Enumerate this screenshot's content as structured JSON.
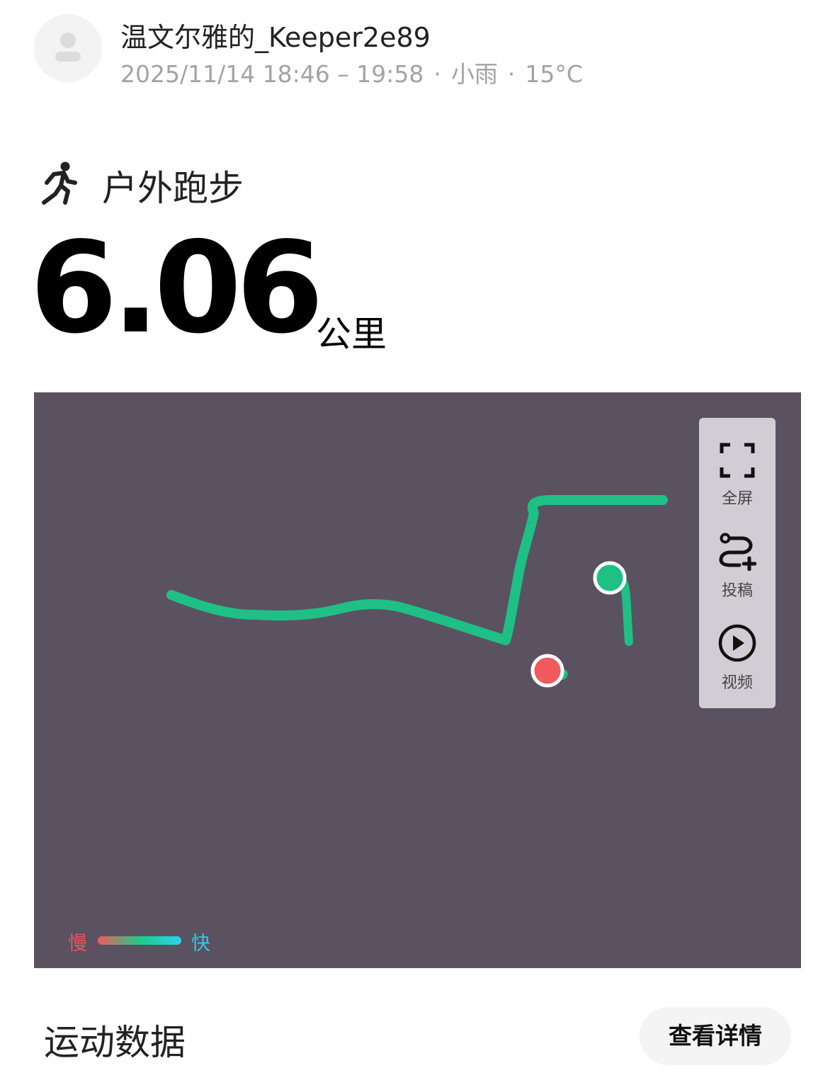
{
  "header": {
    "username": "温文尔雅的_Keeper2e89",
    "time_range": "2025/11/14 18:46 – 19:58",
    "separator": "·",
    "weather": "小雨",
    "temperature": "15°C"
  },
  "activity": {
    "type_label": "户外跑步",
    "icon": "running-person-icon",
    "distance_value": "6.06",
    "distance_unit": "公里"
  },
  "map": {
    "background_color": "#5a5261",
    "route_color": "#1ec086",
    "start_marker_color": "#1ec086",
    "end_marker_color": "#f05a5e",
    "tools": [
      {
        "label": "全屏",
        "icon": "fullscreen-icon"
      },
      {
        "label": "投稿",
        "icon": "route-add-icon"
      },
      {
        "label": "视频",
        "icon": "play-circle-icon"
      }
    ],
    "legend": {
      "slow_label": "慢",
      "fast_label": "快"
    }
  },
  "section": {
    "title": "运动数据",
    "details_button": "查看详情"
  }
}
